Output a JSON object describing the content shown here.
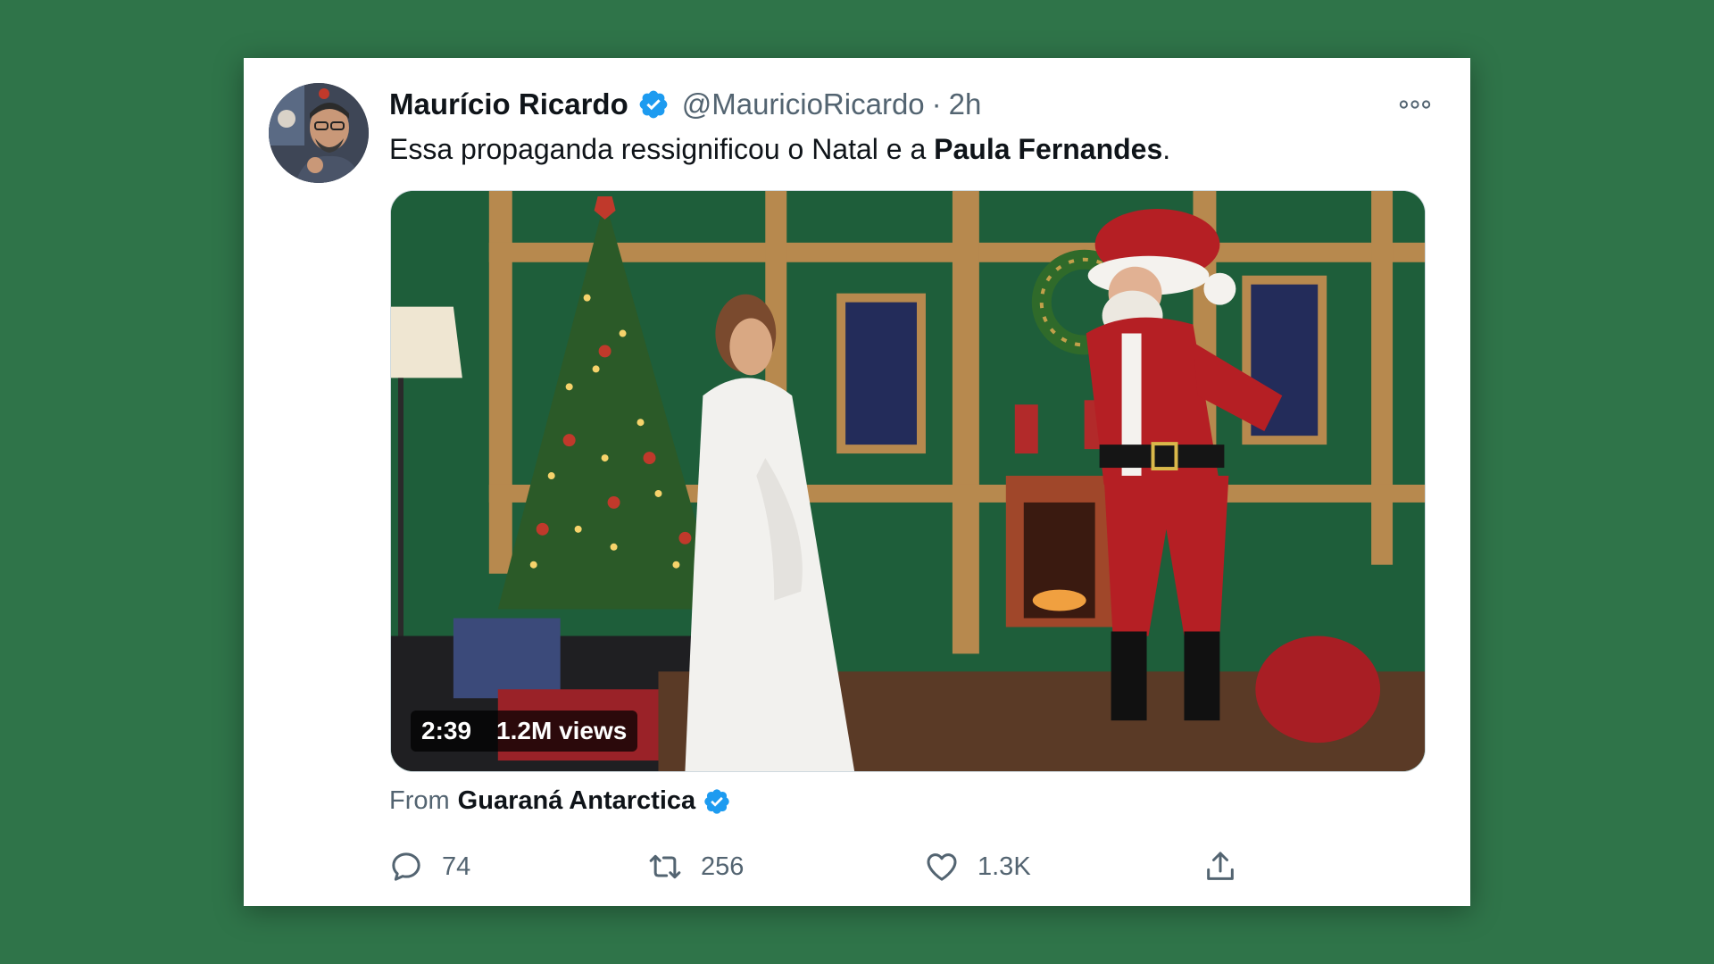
{
  "tweet": {
    "author": {
      "display_name": "Maurício Ricardo",
      "handle": "@MauricioRicardo",
      "verified": true
    },
    "separator": "·",
    "time": "2h",
    "text_before": "Essa propaganda ressignificou o Natal e a ",
    "text_bold": "Paula Fernandes",
    "text_after": ".",
    "video": {
      "duration": "2:39",
      "views": "1.2M views"
    },
    "source": {
      "prefix": "From",
      "name": "Guaraná Antarctica",
      "verified": true
    },
    "actions": {
      "reply_count": "74",
      "retweet_count": "256",
      "like_count": "1.3K"
    }
  },
  "colors": {
    "background": "#2f7449",
    "verified": "#1d9bf0",
    "muted_text": "#536471",
    "text": "#0f1419"
  },
  "icons": [
    "verified-badge-icon",
    "more-options-icon",
    "reply-icon",
    "retweet-icon",
    "like-icon",
    "share-icon"
  ]
}
